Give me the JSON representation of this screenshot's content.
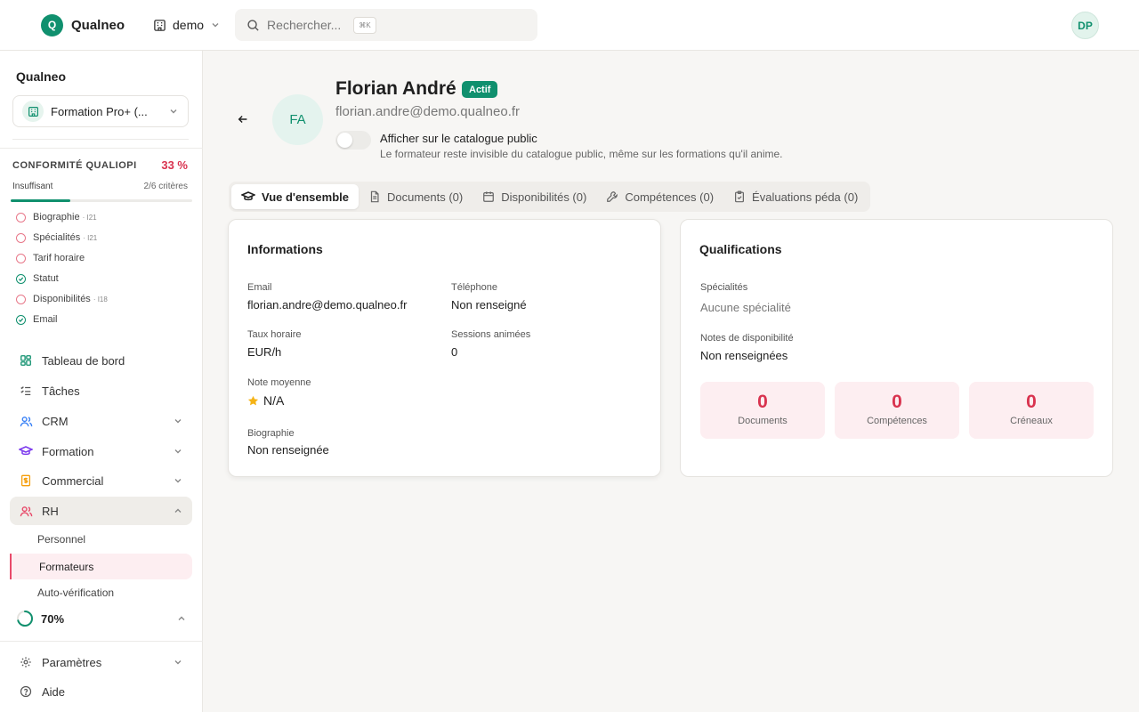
{
  "topbar": {
    "logo_letter": "Q",
    "brand": "Qualneo",
    "workspace": "demo",
    "search_placeholder": "Rechercher...",
    "search_shortcut": "⌘K",
    "user_initials": "DP"
  },
  "sidebar": {
    "org_name": "Qualneo",
    "org_select": "Formation Pro+ (...",
    "conformity": {
      "title": "CONFORMITÉ QUALIOPI",
      "percent": "33 %",
      "level": "Insuffisant",
      "count": "2/6 critères",
      "progress": 0.33,
      "criteria": [
        {
          "label": "Biographie",
          "tag": "· I21",
          "ok": false
        },
        {
          "label": "Spécialités",
          "tag": "· I21",
          "ok": false
        },
        {
          "label": "Tarif horaire",
          "tag": "",
          "ok": false
        },
        {
          "label": "Statut",
          "tag": "",
          "ok": true
        },
        {
          "label": "Disponibilités",
          "tag": "· I18",
          "ok": false
        },
        {
          "label": "Email",
          "tag": "",
          "ok": true
        }
      ]
    },
    "nav": {
      "dashboard": "Tableau de bord",
      "tasks": "Tâches",
      "crm": "CRM",
      "formation": "Formation",
      "commercial": "Commercial",
      "rh": "RH",
      "rh_sub": {
        "personnel": "Personnel",
        "formateurs": "Formateurs",
        "auto": "Auto-vérification"
      },
      "progress_label": "70%",
      "progress_value": 0.7,
      "settings": "Paramètres",
      "help": "Aide"
    }
  },
  "profile": {
    "initials": "FA",
    "name": "Florian André",
    "status": "Actif",
    "email": "florian.andre@demo.qualneo.fr",
    "toggle_label": "Afficher sur le catalogue public",
    "toggle_desc": "Le formateur reste invisible du catalogue public, même sur les formations qu'il anime.",
    "toggle_on": false
  },
  "tabs": [
    {
      "label": "Vue d'ensemble",
      "icon": "graduation-cap-icon"
    },
    {
      "label": "Documents (0)",
      "icon": "document-icon"
    },
    {
      "label": "Disponibilités (0)",
      "icon": "calendar-icon"
    },
    {
      "label": "Compétences (0)",
      "icon": "wrench-icon"
    },
    {
      "label": "Évaluations péda (0)",
      "icon": "clipboard-icon"
    }
  ],
  "informations": {
    "title": "Informations",
    "email_label": "Email",
    "email_value": "florian.andre@demo.qualneo.fr",
    "phone_label": "Téléphone",
    "phone_value": "Non renseigné",
    "rate_label": "Taux horaire",
    "rate_value": "EUR/h",
    "sessions_label": "Sessions animées",
    "sessions_value": "0",
    "rating_label": "Note moyenne",
    "rating_value": "N/A",
    "bio_label": "Biographie",
    "bio_value": "Non renseignée"
  },
  "qualifications": {
    "title": "Qualifications",
    "spec_label": "Spécialités",
    "spec_value": "Aucune spécialité",
    "avail_label": "Notes de disponibilité",
    "avail_value": "Non renseignées",
    "stats": [
      {
        "value": "0",
        "label": "Documents"
      },
      {
        "value": "0",
        "label": "Compétences"
      },
      {
        "value": "0",
        "label": "Créneaux"
      }
    ]
  },
  "colors": {
    "accent": "#10906e",
    "danger": "#d9334f",
    "danger_bg": "#fdeef1"
  }
}
